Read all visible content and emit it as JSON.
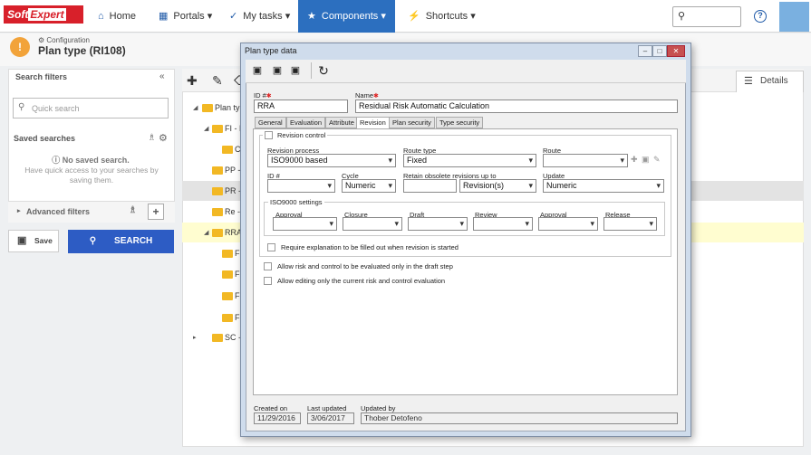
{
  "brand": {
    "part1": "Soft",
    "part2": "Expert"
  },
  "nav": {
    "home": "Home",
    "portals": "Portals",
    "mytasks": "My tasks",
    "components": "Components",
    "shortcuts": "Shortcuts"
  },
  "header": {
    "breadcrumb": "Configuration",
    "title": "Plan type (RI108)"
  },
  "filters": {
    "title": "Search filters",
    "quick_placeholder": "Quick search",
    "saved_title": "Saved searches",
    "no_saved": "No saved search.",
    "no_saved_desc": "Have quick access to your searches by saving them.",
    "advanced": "Advanced filters",
    "save_label": "Save",
    "search_label": "SEARCH"
  },
  "main": {
    "details_tab": "Details",
    "tree": [
      {
        "label": "Plan typ"
      },
      {
        "label": "FI - F"
      },
      {
        "label": "C"
      },
      {
        "label": "PP -"
      },
      {
        "label": "PR -"
      },
      {
        "label": "Re -"
      },
      {
        "label": "RRA"
      },
      {
        "label": "F"
      },
      {
        "label": "F"
      },
      {
        "label": "F"
      },
      {
        "label": "F"
      },
      {
        "label": "SC -"
      }
    ]
  },
  "dialog": {
    "title": "Plan type data",
    "id_label": "ID #",
    "id_value": "RRA",
    "name_label": "Name",
    "name_value": "Residual Risk Automatic Calculation",
    "tabs": [
      "General",
      "Evaluation",
      "Attribute",
      "Revision",
      "Plan security",
      "Type security"
    ],
    "revision_control": "Revision control",
    "revision_process_label": "Revision process",
    "revision_process_value": "ISO9000 based",
    "route_type_label": "Route type",
    "route_type_value": "Fixed",
    "route_label": "Route",
    "id2_label": "ID #",
    "cycle_label": "Cycle",
    "cycle_value": "Numeric",
    "retain_label": "Retain obsolete revisions up to",
    "retain_unit": "Revision(s)",
    "update_label": "Update",
    "update_value": "Numeric",
    "iso_title": "ISO9000 settings",
    "iso_cols": [
      "Approval",
      "Closure",
      "Draft",
      "Review",
      "Approval",
      "Release"
    ],
    "require_expl": "Require explanation to be filled out when revision is started",
    "allow_draft": "Allow risk and control to be evaluated only in the draft step",
    "allow_edit": "Allow editing only the current risk and control evaluation",
    "created_label": "Created on",
    "created_value": "11/29/2016",
    "updated_label": "Last updated",
    "updated_value": "3/06/2017",
    "updated_by_label": "Updated by",
    "updated_by_value": "Thober Detofeno"
  }
}
